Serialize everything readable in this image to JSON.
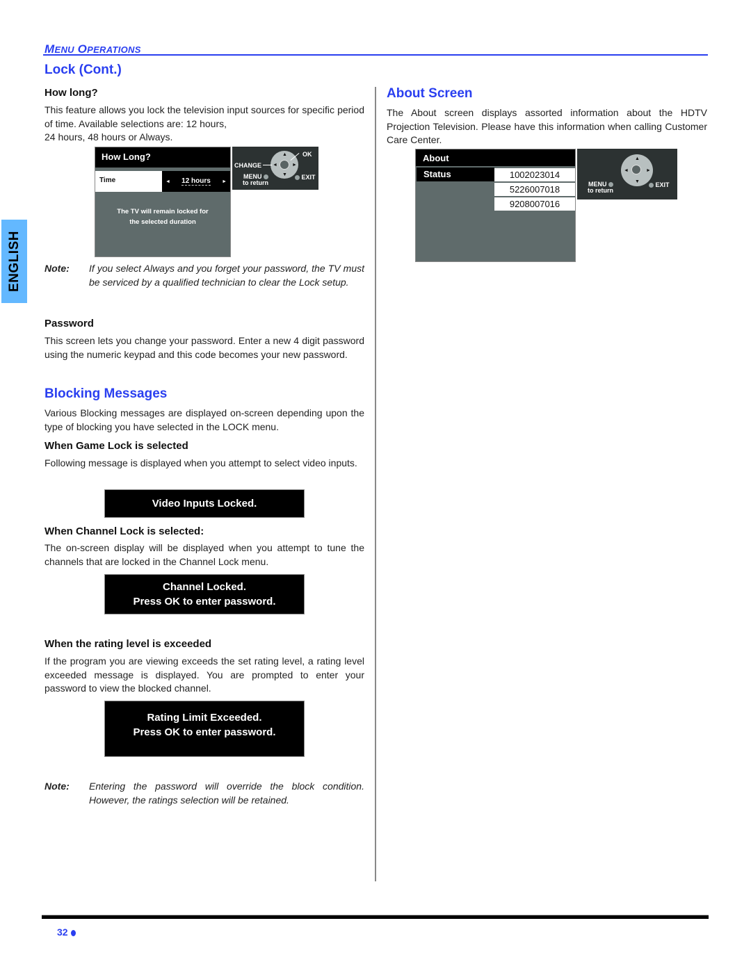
{
  "header": {
    "section_label_first_cap": "M",
    "section_label_first_rest": "ENU",
    "section_label_second_cap": "O",
    "section_label_second_rest": "PERATIONS",
    "page_title": "Lock (Cont.)"
  },
  "side_tab": {
    "label": "ENGLISH"
  },
  "left_column": {
    "how_long": {
      "heading": "How long?",
      "body": "This feature allows you lock the television input sources for specific period of time. Available selections are: 12 hours,",
      "body_line3": "24 hours, 48 hours or Always.",
      "screen": {
        "title": "How Long?",
        "row_label": "Time",
        "value": "12 hours",
        "left_arrow": "◄",
        "right_arrow": "►",
        "message_line1": "The TV will remain locked for",
        "message_line2": "the selected duration"
      },
      "remote": {
        "ok": "OK",
        "change": "CHANGE",
        "menu": "MENU",
        "to_return": "to return",
        "exit": "EXIT"
      }
    },
    "note1": {
      "label": "Note:",
      "text": "If you select Always and you forget your password, the TV must be serviced by a qualified technician to clear the Lock setup."
    },
    "password": {
      "heading": "Password",
      "body": "This screen lets you change your password. Enter a new 4 digit password using the numeric keypad and this code becomes your new password."
    },
    "blocking": {
      "heading": "Blocking Messages",
      "body": "Various Blocking messages are displayed on-screen depending upon the type of blocking you have selected in the LOCK menu.",
      "game_lock": {
        "heading": "When Game Lock is selected",
        "body": "Following message is displayed when you attempt to select video inputs.",
        "message": "Video Inputs Locked."
      },
      "channel_lock": {
        "heading": "When Channel Lock is selected:",
        "body": "The on-screen display will be displayed when you attempt to tune the channels that are locked in the Channel Lock menu.",
        "message_line1": "Channel Locked.",
        "message_line2": "Press OK to enter password."
      },
      "rating": {
        "heading": "When the rating level is exceeded",
        "body": "If the program you are viewing exceeds the set rating level, a rating level exceeded message is displayed. You are prompted to enter your password to view the blocked channel.",
        "message_line1": "Rating Limit Exceeded.",
        "message_line2": "Press OK to enter password."
      }
    },
    "note2": {
      "label": "Note:",
      "text": "Entering the password will override the block condition. However, the ratings selection will be retained."
    }
  },
  "right_column": {
    "about": {
      "heading": "About Screen",
      "body": "The About screen displays assorted information about the HDTV Projection Television. Please have this information when calling Customer Care Center.",
      "screen": {
        "title": "About",
        "row_label": "Status",
        "values": [
          "1002023014",
          "5226007018",
          "9208007016"
        ]
      },
      "remote": {
        "menu": "MENU",
        "to_return": "to return",
        "exit": "EXIT"
      }
    }
  },
  "footer": {
    "page_number": "32"
  },
  "colors": {
    "accent_blue": "#2a3ff0",
    "tab_blue": "#63b8ff",
    "tv_panel": "#5f6b6b",
    "remote_bg": "#2c3232"
  }
}
